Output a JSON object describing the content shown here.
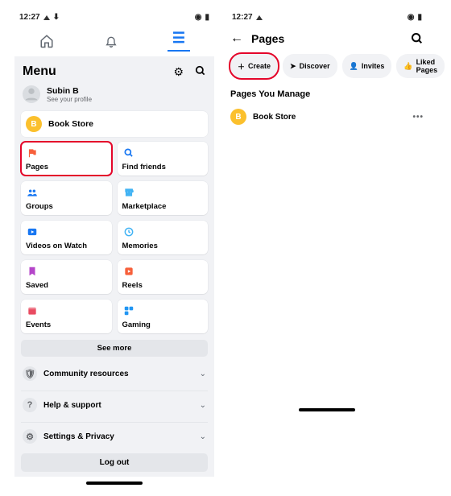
{
  "left": {
    "status_time": "12:27",
    "menu_title": "Menu",
    "profile": {
      "name": "Subin B",
      "subtitle": "See your profile"
    },
    "page_shortcut": {
      "letter": "B",
      "label": "Book Store"
    },
    "tiles": [
      {
        "label": "Pages",
        "icon": "flag",
        "color": "#f7603b",
        "highlight": true
      },
      {
        "label": "Find friends",
        "icon": "search-p",
        "color": "#1877f2",
        "highlight": false
      },
      {
        "label": "Groups",
        "icon": "groups",
        "color": "#1877f2",
        "highlight": false
      },
      {
        "label": "Marketplace",
        "icon": "store",
        "color": "#42b3f4",
        "highlight": false
      },
      {
        "label": "Videos on Watch",
        "icon": "play",
        "color": "#1877f2",
        "highlight": false
      },
      {
        "label": "Memories",
        "icon": "clock",
        "color": "#42b3f4",
        "highlight": false
      },
      {
        "label": "Saved",
        "icon": "bookmark",
        "color": "#b445c9",
        "highlight": false
      },
      {
        "label": "Reels",
        "icon": "reels",
        "color": "#f7603b",
        "highlight": false
      },
      {
        "label": "Events",
        "icon": "calendar",
        "color": "#e94b61",
        "highlight": false
      },
      {
        "label": "Gaming",
        "icon": "gaming",
        "color": "#2196f3",
        "highlight": false
      }
    ],
    "see_more": "See more",
    "expanders": [
      {
        "label": "Community resources"
      },
      {
        "label": "Help & support"
      },
      {
        "label": "Settings & Privacy"
      }
    ],
    "logout": "Log out"
  },
  "right": {
    "status_time": "12:27",
    "header": "Pages",
    "chips": [
      {
        "label": "Create",
        "icon": "plus",
        "highlight": true
      },
      {
        "label": "Discover",
        "icon": "compass",
        "highlight": false
      },
      {
        "label": "Invites",
        "icon": "person",
        "highlight": false
      },
      {
        "label": "Liked Pages",
        "icon": "thumb",
        "highlight": false
      }
    ],
    "section_title": "Pages You Manage",
    "managed": [
      {
        "letter": "B",
        "name": "Book Store"
      }
    ]
  }
}
